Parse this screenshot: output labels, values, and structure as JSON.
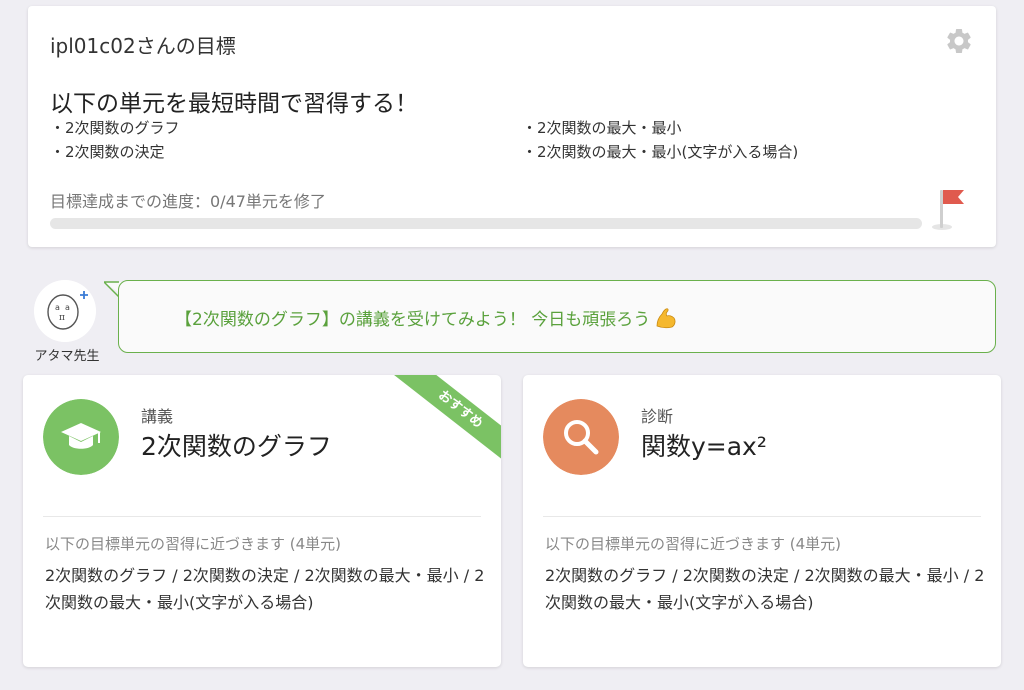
{
  "goal": {
    "title": "ipl01c02さんの目標",
    "heading": "以下の単元を最短時間で習得する！",
    "units": [
      "2次関数のグラフ",
      "2次関数の最大・最小",
      "2次関数の決定",
      "2次関数の最大・最小(文字が入る場合)"
    ],
    "progress_label": "目標達成までの進度：0/47単元を修了",
    "progress_done": 0,
    "progress_total": 47
  },
  "teacher": {
    "name": "アタマ先生",
    "message": "【2次関数のグラフ】の講義を受けてみよう！ 今日も頑張ろう"
  },
  "cards": [
    {
      "type": "講義",
      "title": "2次関数のグラフ",
      "badge": "おすすめ",
      "subtitle": "以下の目標単元の習得に近づきます (4単元)",
      "description": "2次関数のグラフ / 2次関数の決定 / 2次関数の最大・最小 / 2次関数の最大・最小(文字が入る場合)",
      "icon": "graduation-cap-icon",
      "color": "#7bc264"
    },
    {
      "type": "診断",
      "title": "関数y=ax²",
      "subtitle": "以下の目標単元の習得に近づきます (4単元)",
      "description": "2次関数のグラフ / 2次関数の決定 / 2次関数の最大・最小 / 2次関数の最大・最小(文字が入る場合)",
      "icon": "magnifier-icon",
      "color": "#e58a5e"
    }
  ],
  "colors": {
    "accent_green": "#6ab04c",
    "flag_red": "#e05a4e",
    "background": "#efeef3"
  }
}
